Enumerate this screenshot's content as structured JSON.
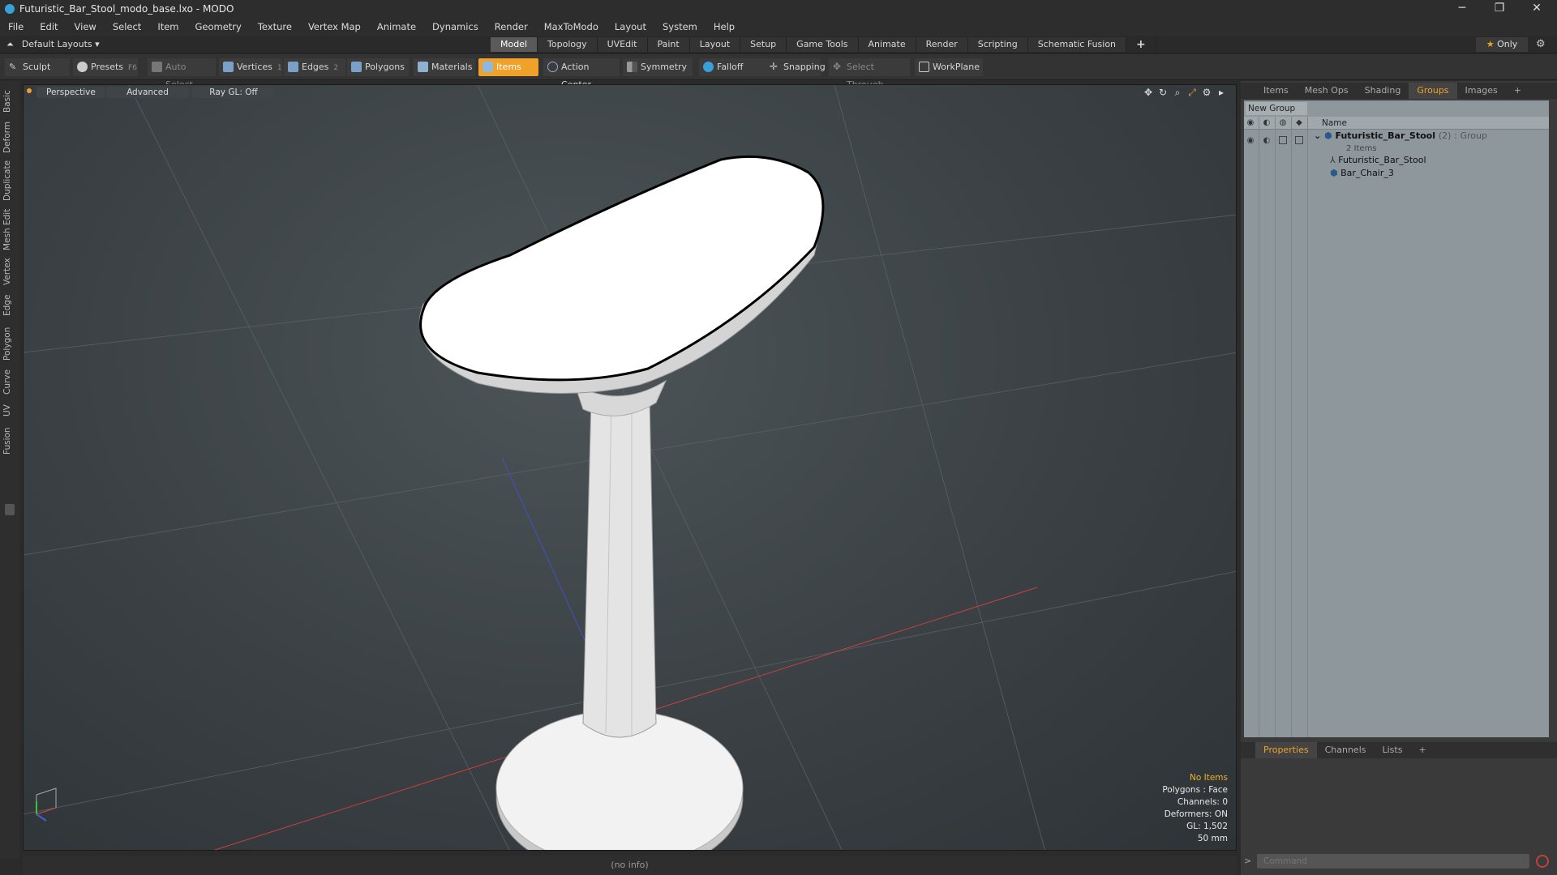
{
  "window": {
    "title": "Futuristic_Bar_Stool_modo_base.lxo - MODO",
    "minimize": "─",
    "maximize": "❐",
    "close": "✕"
  },
  "menu": [
    "File",
    "Edit",
    "View",
    "Select",
    "Item",
    "Geometry",
    "Texture",
    "Vertex Map",
    "Animate",
    "Dynamics",
    "Render",
    "MaxToModo",
    "Layout",
    "System",
    "Help"
  ],
  "layoutbar": {
    "default_layouts": "Default Layouts ▾",
    "tabs": [
      "Model",
      "Topology",
      "UVEdit",
      "Paint",
      "Layout",
      "Setup",
      "Game Tools",
      "Animate",
      "Render",
      "Scripting",
      "Schematic Fusion"
    ],
    "active_tab": "Model",
    "add": "+",
    "only_label": "Only"
  },
  "toolbar": {
    "sculpt": "Sculpt",
    "presets": "Presets",
    "presets_key": "F6",
    "auto_select": "Auto Select",
    "vertices": "Vertices",
    "vertices_key": "1",
    "edges": "Edges",
    "edges_key": "2",
    "polygons": "Polygons",
    "materials": "Materials",
    "items": "Items",
    "action_center": "Action Center",
    "symmetry": "Symmetry",
    "falloff": "Falloff",
    "snapping": "Snapping",
    "select_through": "Select Through",
    "workplane": "WorkPlane"
  },
  "left_tabs": [
    "Basic",
    "Deform",
    "Duplicate",
    "Mesh Edit",
    "Vertex",
    "Edge",
    "Polygon",
    "Curve",
    "UV",
    "Fusion"
  ],
  "viewport": {
    "perspective": "Perspective",
    "advanced": "Advanced",
    "raygl": "Ray GL: Off",
    "info": {
      "no_items": "No Items",
      "polygons": "Polygons : Face",
      "channels": "Channels: 0",
      "deformers": "Deformers: ON",
      "gl": "GL: 1,502",
      "scale": "50 mm"
    }
  },
  "status": "(no info)",
  "right_panel": {
    "tabs": [
      "Items",
      "Mesh Ops",
      "Shading",
      "Groups",
      "Images"
    ],
    "active_tab": "Groups",
    "new_group": "New Group",
    "name_header": "Name",
    "group": {
      "name": "Futuristic_Bar_Stool",
      "count": "(2)",
      "type": ": Group",
      "items_label": "2 Items"
    },
    "children": [
      "Futuristic_Bar_Stool",
      "Bar_Chair_3"
    ],
    "bottom_tabs": [
      "Properties",
      "Channels",
      "Lists"
    ],
    "bottom_active": "Properties"
  },
  "command": {
    "prompt": ">",
    "placeholder": "Command"
  },
  "colors": {
    "accent": "#f0a12a",
    "x_axis": "#c84040",
    "z_axis": "#4050c8"
  }
}
